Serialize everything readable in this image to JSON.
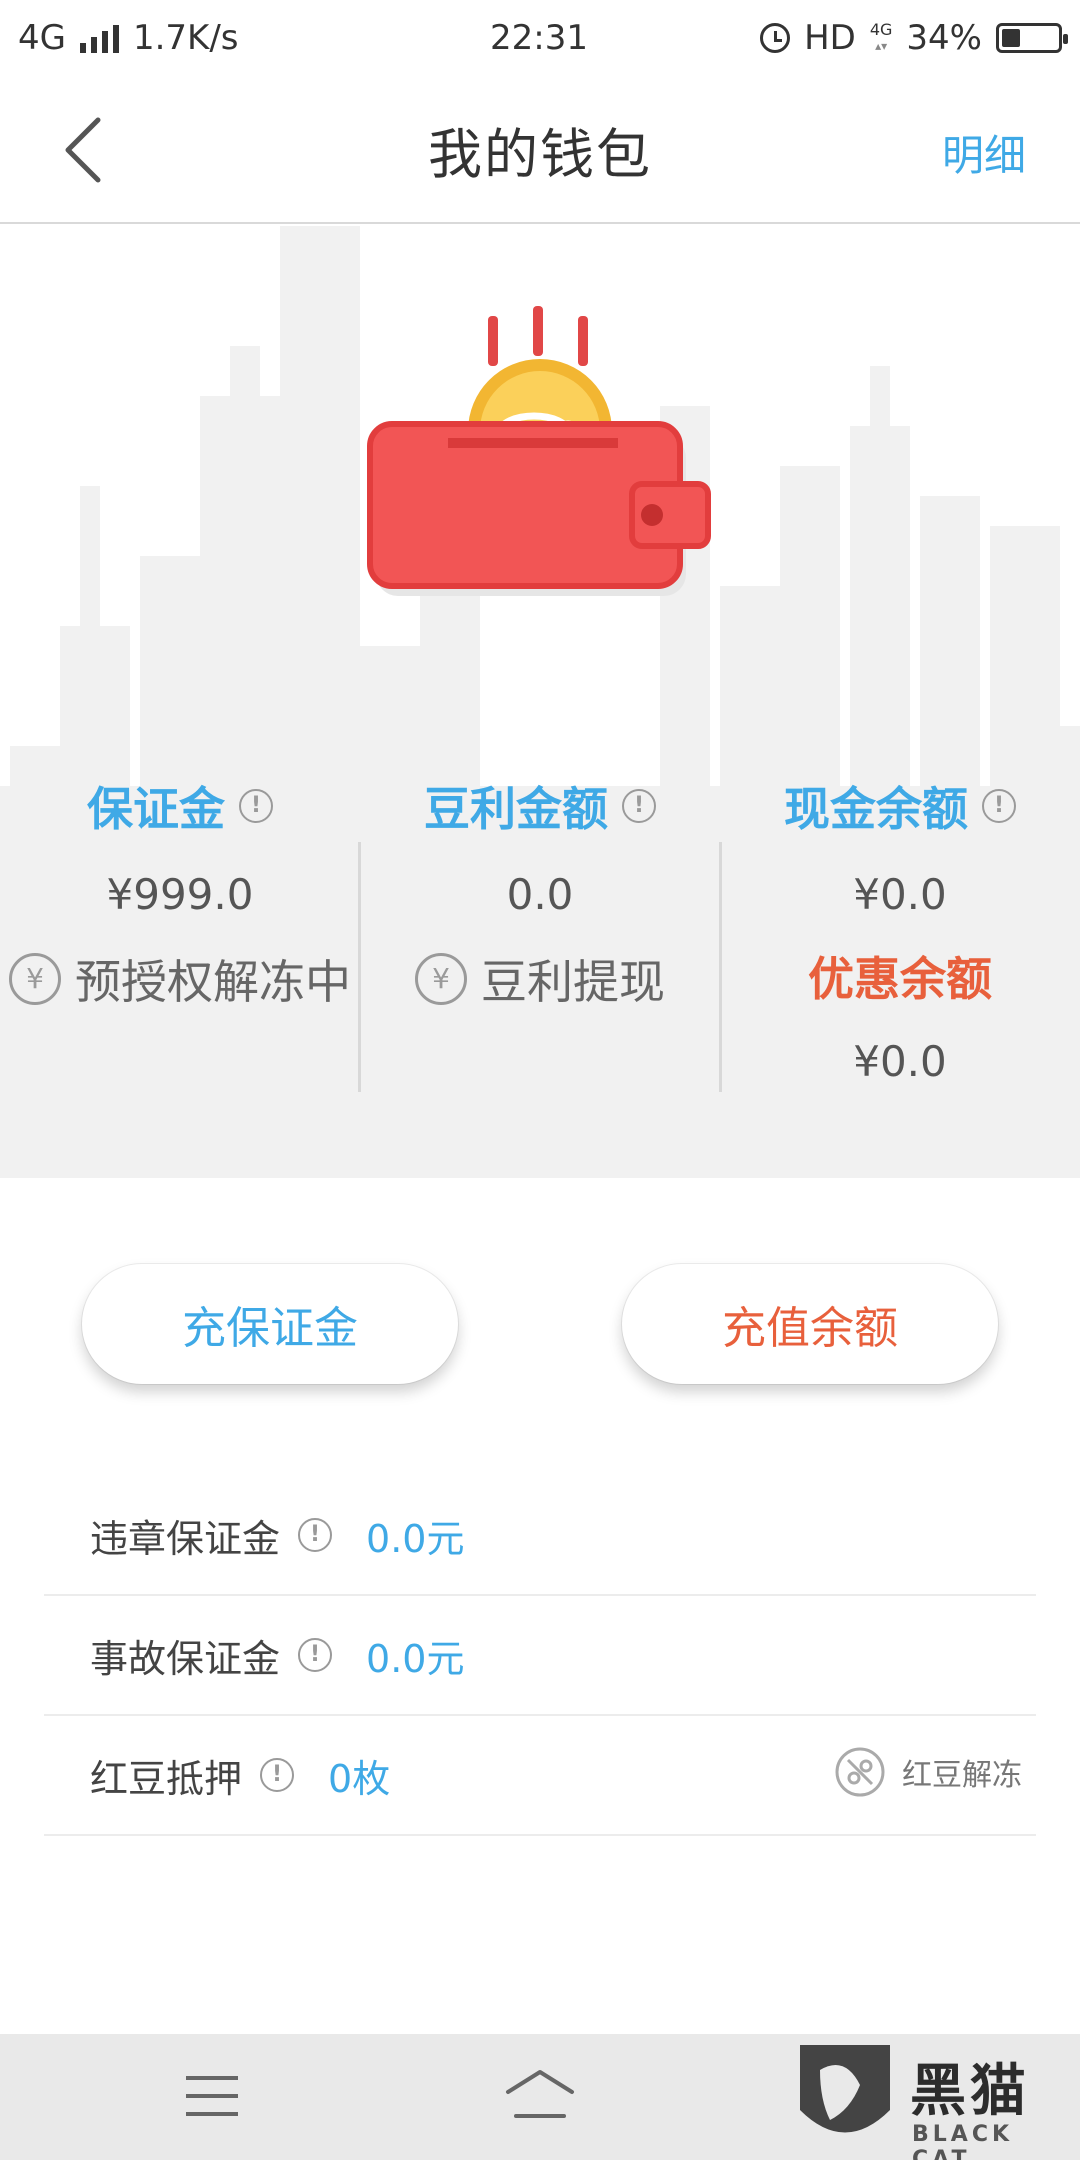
{
  "status_bar": {
    "network": "4G",
    "speed": "1.7K/s",
    "time": "22:31",
    "hd": "HD",
    "net_type": "4G",
    "battery": "34%",
    "battery_level": 0.34
  },
  "header": {
    "title": "我的钱包",
    "detail_link": "明细"
  },
  "stats": {
    "deposit": {
      "label": "保证金",
      "value": "¥999.0",
      "action": "预授权解冻中",
      "action_icon": "yen-icon"
    },
    "beans": {
      "label": "豆利金额",
      "value": "0.0",
      "action": "豆利提现",
      "action_icon": "yen-icon"
    },
    "cash": {
      "label": "现金余额",
      "value": "¥0.0",
      "promo_label": "优惠余额",
      "promo_value": "¥0.0"
    }
  },
  "buttons": {
    "deposit": "充保证金",
    "topup": "充值余额"
  },
  "list": [
    {
      "label": "违章保证金",
      "value": "0.0元"
    },
    {
      "label": "事故保证金",
      "value": "0.0元"
    },
    {
      "label": "红豆抵押",
      "value": "0枚",
      "action": "红豆解冻"
    }
  ],
  "watermark": {
    "text": "黑猫",
    "sub": "BLACK CAT"
  },
  "colors": {
    "accent": "#3fa9e6",
    "highlight": "#e8603c",
    "wallet": "#f25555"
  }
}
